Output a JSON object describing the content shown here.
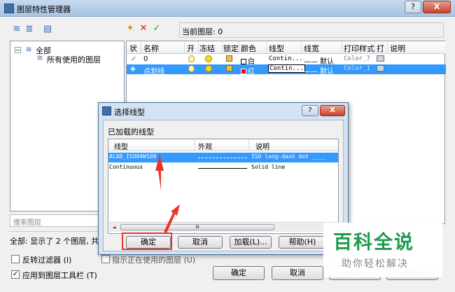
{
  "window": {
    "title": "图层特性管理器",
    "app_icon": "AutoCAD",
    "help": "?",
    "close": "X"
  },
  "toolbar": {
    "current_layer_label": "当前图层: 0"
  },
  "tree": {
    "root": "全部",
    "child": "所有使用的图层",
    "expander": "−"
  },
  "layer_table": {
    "headers": [
      "状",
      "名称",
      "开",
      "冻结",
      "锁定",
      "颜色",
      "线型",
      "线宽",
      "打印样式",
      "打",
      "说明"
    ],
    "rows": [
      {
        "status": "✓",
        "name": "0",
        "color_name": "白",
        "color": "#ffffff",
        "linetype": "Contin...",
        "lineweight": "—— 默认",
        "plot_style": "Color_7"
      },
      {
        "status": "◈",
        "name": "点划线",
        "color_name": "红",
        "color": "#ff0000",
        "linetype": "Contin...",
        "lineweight": "—— 默认",
        "plot_style": "Color_1"
      }
    ]
  },
  "search": {
    "placeholder": "搜索图层"
  },
  "status": {
    "text": "全部: 显示了 2 个图层, 共"
  },
  "options": {
    "invert_filter": "反转过滤器 (I)",
    "apply_to_toolbar": "应用到图层工具栏 (T)",
    "indicate_used": "指示正在使用的图层 (U)",
    "invert_checked": false,
    "toolbar_checked": true
  },
  "main_buttons": {
    "ok": "确定",
    "cancel": "取消",
    "apply": "应用",
    "help": "帮助"
  },
  "dialog": {
    "title": "选择线型",
    "app_icon": "AutoCAD",
    "help": "?",
    "close": "X",
    "section": "已加载的线型",
    "headers": [
      "线型",
      "外观",
      "说明"
    ],
    "rows": [
      {
        "name": "ACAD_ISO04W100",
        "desc": "ISO long-dash dot ____"
      },
      {
        "name": "Continuous",
        "desc": "Solid line"
      }
    ],
    "scroll_left": "◄",
    "scroll_right": "►",
    "scroll_thumb": "III",
    "buttons": {
      "ok": "确定",
      "cancel": "取消",
      "load": "加载(L)...",
      "help": "帮助(H)"
    }
  },
  "watermark": {
    "title": "百科全说",
    "subtitle": "助你轻松解决"
  },
  "accent_colors": {
    "selection": "#3399ff",
    "annotation": "#e8362a",
    "watermark_green": "#1c9c4a"
  },
  "icons": [
    "new-layer-icon",
    "delete-layer-icon",
    "set-current-icon",
    "new-filter-icon",
    "group-filter-icon",
    "layer-states-icon"
  ]
}
